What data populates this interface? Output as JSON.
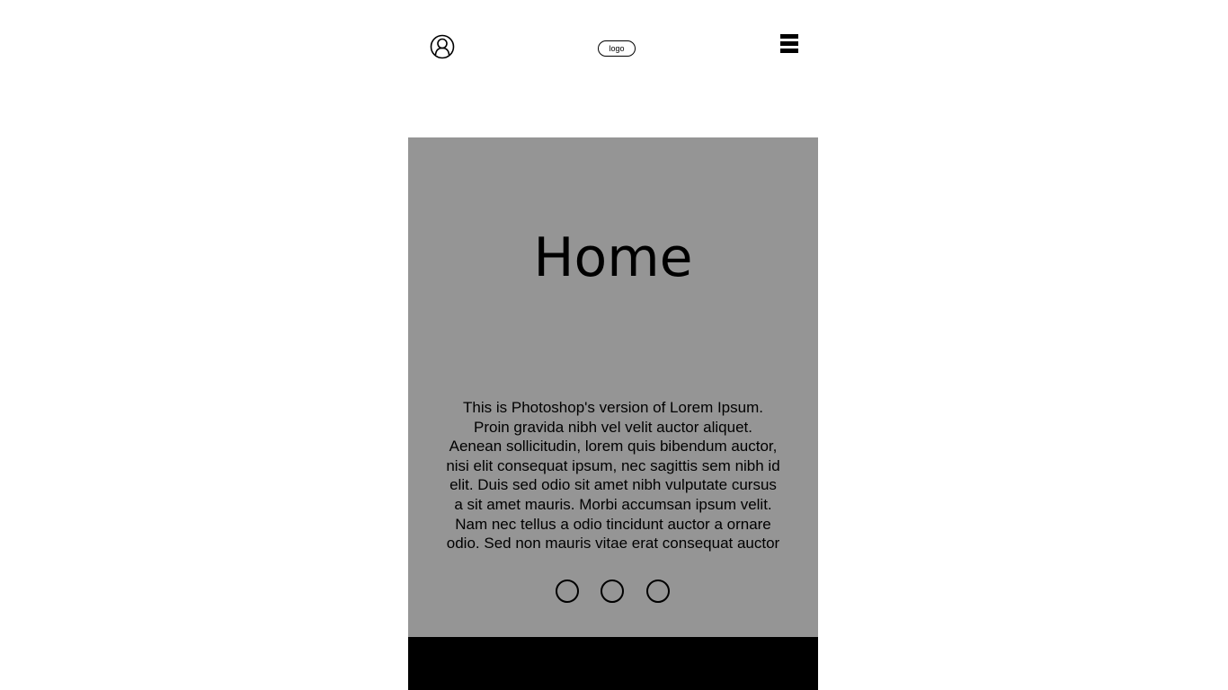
{
  "header": {
    "user_icon": "user-icon",
    "logo_label": "logo",
    "menu_icon": "hamburger-menu-icon"
  },
  "hero": {
    "title": "Home",
    "body": "This is Photoshop's version  of Lorem Ipsum.\nProin gravida nibh vel velit auctor aliquet.\nAenean sollicitudin, lorem quis bibendum auctor,\nnisi elit consequat ipsum, nec sagittis sem nibh id\nelit. Duis sed odio sit amet nibh vulputate cursus\na sit amet mauris. Morbi accumsan ipsum velit.\nNam nec tellus a odio tincidunt auctor a ornare\nodio. Sed non  mauris vitae erat consequat auctor",
    "background_color": "#959595",
    "carousel_dots": 3
  },
  "footer": {
    "background_color": "#000000"
  }
}
